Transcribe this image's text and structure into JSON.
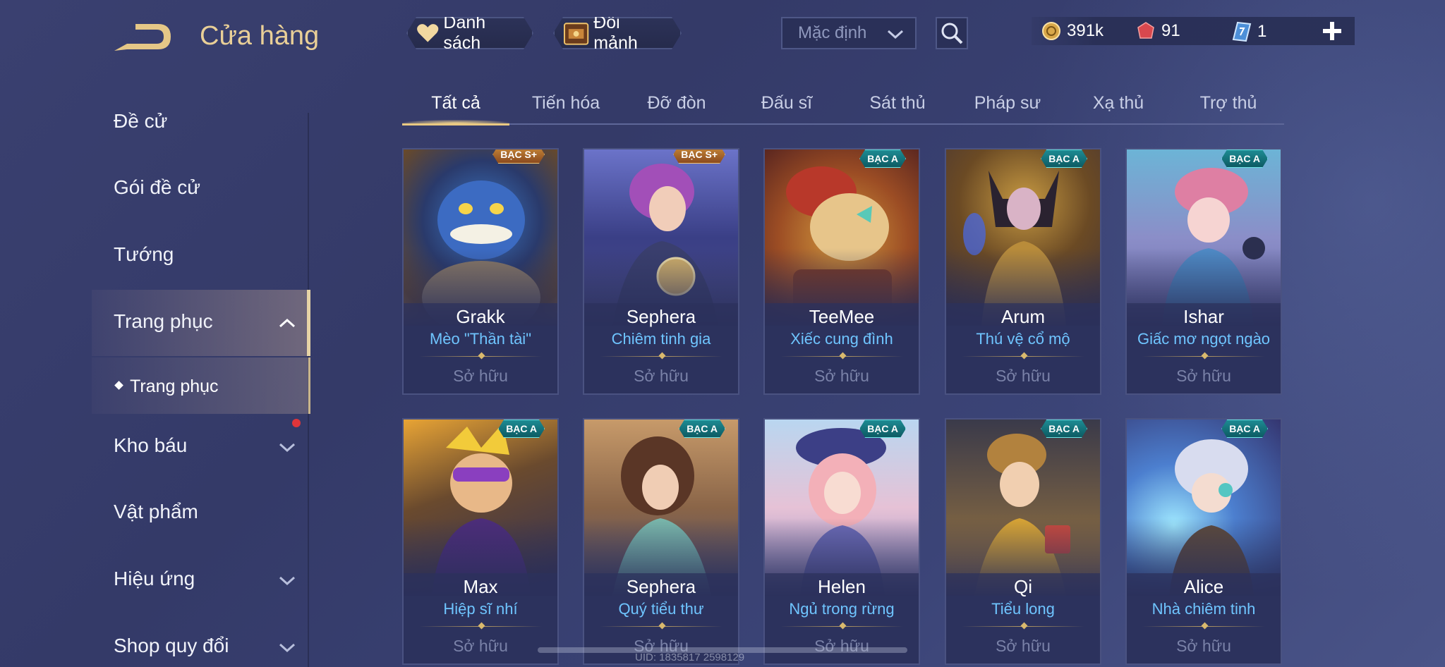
{
  "header": {
    "title": "Cửa hàng",
    "list_label": "Danh sách",
    "shard_label": "Đổi mảnh",
    "sort_value": "Mặc định"
  },
  "currency": {
    "gold": "391k",
    "ruby": "91",
    "card": "1"
  },
  "sidebar": {
    "items": [
      {
        "label": "Đề cử"
      },
      {
        "label": "Gói đề cử"
      },
      {
        "label": "Tướng"
      },
      {
        "label": "Trang phục"
      },
      {
        "label": "Kho báu"
      },
      {
        "label": "Vật phẩm"
      },
      {
        "label": "Hiệu ứng"
      },
      {
        "label": "Shop quy đổi"
      }
    ],
    "sub_item": "Trang phục"
  },
  "tabs": [
    "Tất cả",
    "Tiến hóa",
    "Đỡ đòn",
    "Đấu sĩ",
    "Sát thủ",
    "Pháp sư",
    "Xạ thủ",
    "Trợ thủ"
  ],
  "cards": [
    {
      "badge": "BẠC S+",
      "hero": "Grakk",
      "skin": "Mèo \"Thần tài\"",
      "status": "Sở hữu"
    },
    {
      "badge": "BẠC S+",
      "hero": "Sephera",
      "skin": "Chiêm tinh gia",
      "status": "Sở hữu"
    },
    {
      "badge": "BẠC A",
      "hero": "TeeMee",
      "skin": "Xiếc cung đình",
      "status": "Sở hữu"
    },
    {
      "badge": "BẠC A",
      "hero": "Arum",
      "skin": "Thú vệ cổ mộ",
      "status": "Sở hữu"
    },
    {
      "badge": "BẠC A",
      "hero": "Ishar",
      "skin": "Giấc mơ ngọt ngào",
      "status": "Sở hữu"
    },
    {
      "badge": "BẠC A",
      "hero": "Max",
      "skin": "Hiệp sĩ nhí",
      "status": "Sở hữu"
    },
    {
      "badge": "BẠC A",
      "hero": "Sephera",
      "skin": "Quý tiểu thư",
      "status": "Sở hữu"
    },
    {
      "badge": "BẠC A",
      "hero": "Helen",
      "skin": "Ngủ trong rừng",
      "status": "Sở hữu"
    },
    {
      "badge": "BẠC A",
      "hero": "Qi",
      "skin": "Tiểu long",
      "status": "Sở hữu"
    },
    {
      "badge": "BẠC A",
      "hero": "Alice",
      "skin": "Nhà chiêm tinh",
      "status": "Sở hữu"
    }
  ],
  "watermark": "UID: 1835817 2598129",
  "colors": {
    "accent_gold": "#e9cf97",
    "skin_name_blue": "#6fc5ff",
    "badge_teal": "#1d8b93",
    "badge_orange": "#c98a3a"
  }
}
